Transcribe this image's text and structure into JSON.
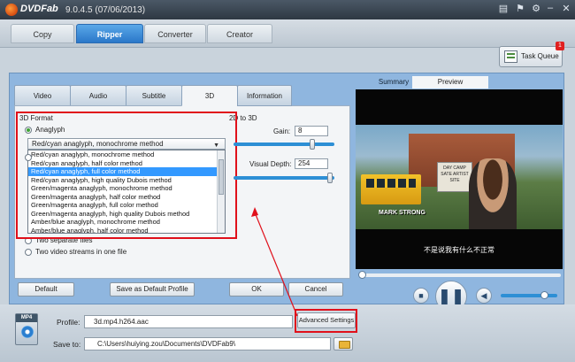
{
  "titlebar": {
    "brand": "DVDFab",
    "version": "9.0.4.5 (07/06/2013)"
  },
  "top_tabs": [
    "Copy",
    "Ripper",
    "Converter",
    "Creator"
  ],
  "task_queue": {
    "label": "Task Queue",
    "badge": "1"
  },
  "settings_tabs": [
    "Video",
    "Audio",
    "Subtitle",
    "3D",
    "Information"
  ],
  "format3d": {
    "heading": "3D Format",
    "two_to_three": "2D to 3D",
    "anaglyph_label": "Anaglyph",
    "selected_method": "Red/cyan anaglyph, monochrome method",
    "options": [
      "Red/cyan anaglyph, monochrome method",
      "Red/cyan anaglyph, half color method",
      "Red/cyan anaglyph, full color method",
      "Red/cyan anaglyph, high quality Dubois method",
      "Green/magenta anaglyph, monochrome method",
      "Green/magenta anaglyph, half color method",
      "Green/magenta anaglyph, full color method",
      "Green/magenta anaglyph, high quality Dubois method",
      "Amber/blue anaglyph, monochrome method",
      "Amber/blue anaglyph, half color method"
    ],
    "highlighted_index": 2,
    "two_separate": "Two separate files",
    "two_streams": "Two video streams in one file",
    "gain_label": "Gain:",
    "gain_value": "8",
    "visual_depth_label": "Visual Depth:",
    "visual_depth_value": "254"
  },
  "buttons": {
    "default": "Default",
    "save_default": "Save as Default Profile",
    "ok": "OK",
    "cancel": "Cancel",
    "advanced": "Advanced Settings"
  },
  "preview_tabs": [
    "Summary",
    "Preview"
  ],
  "video": {
    "sign_text": "DAY CAMP SATE ARTIST SITE",
    "name_tag": "MARK STRONG",
    "subtitle": "不是说我有什么不正常"
  },
  "bottom": {
    "icon_tag": "MP4",
    "profile_label": "Profile:",
    "profile_value": "3d.mp4.h264.aac",
    "saveto_label": "Save to:",
    "saveto_value": "C:\\Users\\huiying.zou\\Documents\\DVDFab9\\"
  },
  "colors": {
    "accent": "#2a77c9",
    "highlight": "#e0101b",
    "selection": "#3399ff"
  }
}
